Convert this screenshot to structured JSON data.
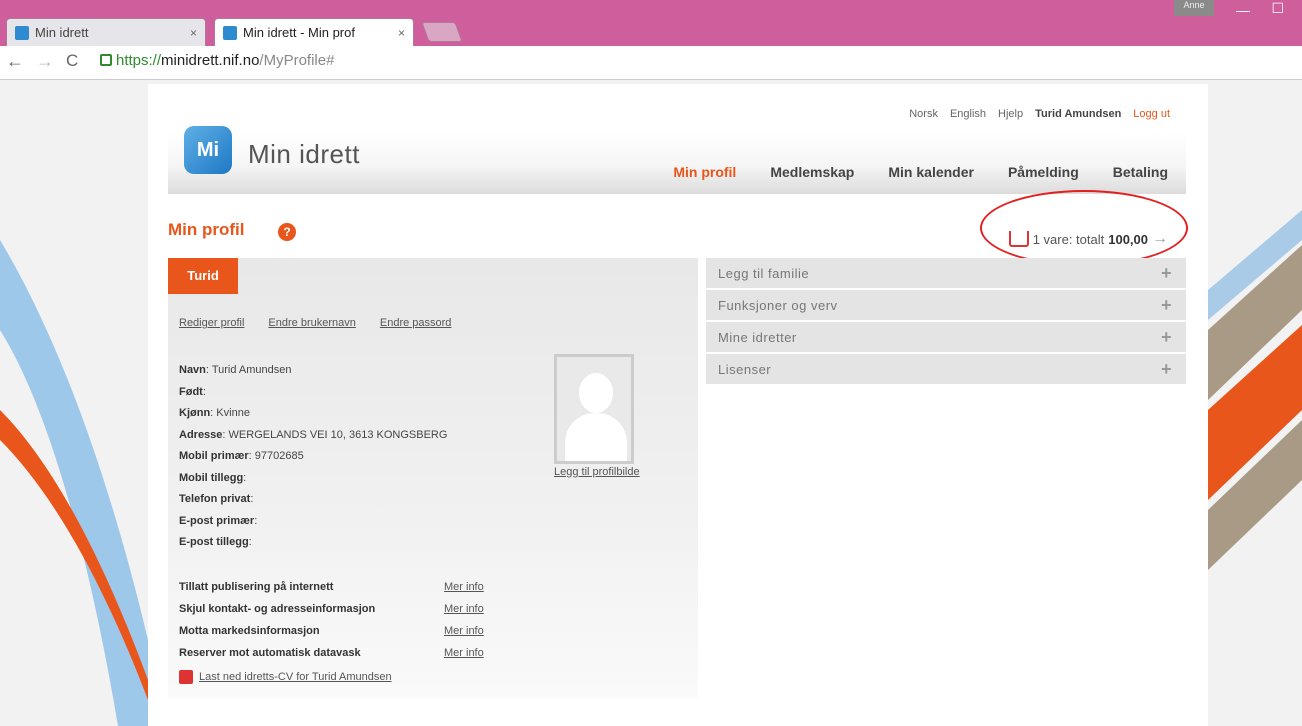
{
  "browser": {
    "tabs": [
      {
        "title": "Min idrett"
      },
      {
        "title": "Min idrett - Min prof"
      }
    ],
    "close_glyph": "×",
    "user_badge": "Anne",
    "url_secure": "https://",
    "url_host": "minidrett.nif.no",
    "url_path": "/MyProfile#"
  },
  "header": {
    "logo_mark": "Mi",
    "logo_text": "Min idrett",
    "top_links": [
      "Norsk",
      "English",
      "Hjelp"
    ],
    "user_name": "Turid Amundsen",
    "logout": "Logg ut",
    "nav": [
      "Min profil",
      "Medlemskap",
      "Min kalender",
      "Påmelding",
      "Betaling"
    ]
  },
  "page": {
    "title": "Min profil",
    "help_glyph": "?"
  },
  "cart": {
    "prefix": "1 vare: totalt",
    "amount": "100,00"
  },
  "profile": {
    "tab_name": "Turid",
    "links": [
      "Rediger profil",
      "Endre brukernavn",
      "Endre passord"
    ],
    "fields": [
      {
        "label": "Navn",
        "value": "Turid Amundsen"
      },
      {
        "label": "Født",
        "value": ""
      },
      {
        "label": "Kjønn",
        "value": "Kvinne"
      },
      {
        "label": "Adresse",
        "value": "WERGELANDS VEI 10, 3613 KONGSBERG"
      },
      {
        "label": "Mobil primær",
        "value": "97702685"
      },
      {
        "label": "Mobil tillegg",
        "value": ""
      },
      {
        "label": "Telefon privat",
        "value": ""
      },
      {
        "label": "E-post primær",
        "value": ""
      },
      {
        "label": "E-post tillegg",
        "value": ""
      }
    ],
    "add_photo": "Legg til profilbilde",
    "settings": [
      "Tillatt publisering på internett",
      "Skjul kontakt- og adresseinformasjon",
      "Motta markedsinformasjon",
      "Reserver mot automatisk datavask"
    ],
    "more_info": "Mer info",
    "cv_link": "Last ned idretts-CV for Turid Amundsen"
  },
  "accordion": [
    "Legg til familie",
    "Funksjoner og verv",
    "Mine idretter",
    "Lisenser"
  ],
  "colors": {
    "accent": "#e8561b",
    "logo": "#2f8bcf",
    "browser_frame": "#cf5f9c"
  }
}
